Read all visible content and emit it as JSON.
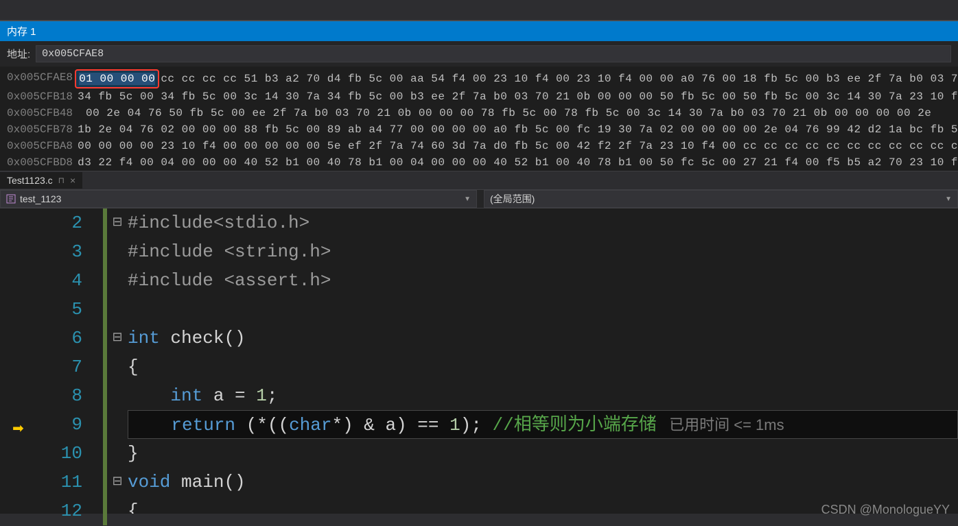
{
  "memory": {
    "title": "内存 1",
    "address_label": "地址:",
    "address_value": "0x005CFAE8",
    "rows": [
      {
        "addr": "0x005CFAE8",
        "highlighted": "01 00 00 00",
        "rest": "cc cc cc cc 51 b3 a2 70 d4 fb 5c 00 aa 54 f4 00 23 10 f4 00 23 10 f4 00 00 a0 76 00 18 fb 5c 00 b3 ee 2f 7a b0 03 7"
      },
      {
        "addr": "0x005CFB18",
        "rest": "34 fb 5c 00 34 fb 5c 00 3c 14 30 7a 34 fb 5c 00 b3 ee 2f 7a b0 03 70 21 0b 00 00 00 50 fb 5c 00 50 fb 5c 00 3c 14 30 7a 23 10 f"
      },
      {
        "addr": "0x005CFB48",
        "rest": "00 2e 04 76 50 fb 5c 00 ee 2f 7a b0 03 70 21 0b 00 00 00 78 fb 5c 00 78 fb 5c 00 3c 14 30 7a b0 03 70 21 0b 00 00 00 00 2e"
      },
      {
        "addr": "0x005CFB78",
        "rest": "1b 2e 04 76 02 00 00 00 88 fb 5c 00 89 ab a4 77 00 00 00 00 a0 fb 5c 00 fc 19 30 7a 02 00 00 00 00 2e 04 76 99 42 d2 1a bc fb 5"
      },
      {
        "addr": "0x005CFBA8",
        "rest": "00 00 00 00 23 10 f4 00 00 00 00 00 5e ef 2f 7a 74 60 3d 7a d0 fb 5c 00 42 f2 2f 7a 23 10 f4 00 cc cc cc cc cc cc cc cc cc cc c"
      },
      {
        "addr": "0x005CFBD8",
        "rest": "d3 22 f4 00 04 00 00 00 40 52 b1 00 40 78 b1 00 04 00 00 00 40 52 b1 00 40 78 b1 00 50 fc 5c 00 27 21 f4 00 f5 b5 a2 70 23 10 f"
      }
    ]
  },
  "tab": {
    "filename": "Test1123.c",
    "pin": "⊓",
    "close": "×"
  },
  "dropdowns": {
    "left_label": "test_1123",
    "right_label": "(全局范围)"
  },
  "code": {
    "lines": [
      {
        "num": "2",
        "fold": "⊟",
        "green": true,
        "tokens": [
          {
            "t": "#include",
            "c": "tok-pp"
          },
          {
            "t": "<stdio.h>",
            "c": "tok-pp"
          }
        ]
      },
      {
        "num": "3",
        "fold": "",
        "green": true,
        "tokens": [
          {
            "t": "#include ",
            "c": "tok-pp"
          },
          {
            "t": "<string.h>",
            "c": "tok-pp"
          }
        ]
      },
      {
        "num": "4",
        "fold": "",
        "green": true,
        "tokens": [
          {
            "t": "#include ",
            "c": "tok-pp"
          },
          {
            "t": "<assert.h>",
            "c": "tok-pp"
          }
        ]
      },
      {
        "num": "5",
        "fold": "",
        "green": true,
        "tokens": []
      },
      {
        "num": "6",
        "fold": "⊟",
        "green": true,
        "tokens": [
          {
            "t": "int",
            "c": "tok-kw"
          },
          {
            "t": " ",
            "c": ""
          },
          {
            "t": "check",
            "c": "tok-fn"
          },
          {
            "t": "()",
            "c": "tok-punc"
          }
        ]
      },
      {
        "num": "7",
        "fold": "",
        "green": true,
        "tokens": [
          {
            "t": "{",
            "c": "tok-punc"
          }
        ]
      },
      {
        "num": "8",
        "fold": "",
        "green": true,
        "tokens": [
          {
            "t": "    ",
            "c": ""
          },
          {
            "t": "int",
            "c": "tok-kw"
          },
          {
            "t": " a = ",
            "c": "tok-punc"
          },
          {
            "t": "1",
            "c": "tok-num"
          },
          {
            "t": ";",
            "c": "tok-punc"
          }
        ]
      },
      {
        "num": "9",
        "fold": "",
        "green": true,
        "current": true,
        "tokens": [
          {
            "t": "    ",
            "c": ""
          },
          {
            "t": "return",
            "c": "tok-kw"
          },
          {
            "t": " (*((",
            "c": "tok-punc"
          },
          {
            "t": "char",
            "c": "tok-kw"
          },
          {
            "t": "*) & a) == ",
            "c": "tok-punc"
          },
          {
            "t": "1",
            "c": "tok-num"
          },
          {
            "t": "); ",
            "c": "tok-punc"
          },
          {
            "t": "//相等则为小端存储",
            "c": "tok-comment"
          },
          {
            "t": "   已用时间 <= 1ms",
            "c": "tok-hint"
          }
        ]
      },
      {
        "num": "10",
        "fold": "",
        "green": true,
        "tokens": [
          {
            "t": "}",
            "c": "tok-punc"
          }
        ]
      },
      {
        "num": "11",
        "fold": "⊟",
        "green": true,
        "tokens": [
          {
            "t": "void",
            "c": "tok-kw"
          },
          {
            "t": " ",
            "c": ""
          },
          {
            "t": "main",
            "c": "tok-fn"
          },
          {
            "t": "()",
            "c": "tok-punc"
          }
        ]
      },
      {
        "num": "12",
        "fold": "",
        "green": true,
        "tokens": [
          {
            "t": "{",
            "c": "tok-punc"
          }
        ]
      }
    ]
  },
  "watermark": "CSDN @MonologueYY",
  "execution_arrow": "➡"
}
